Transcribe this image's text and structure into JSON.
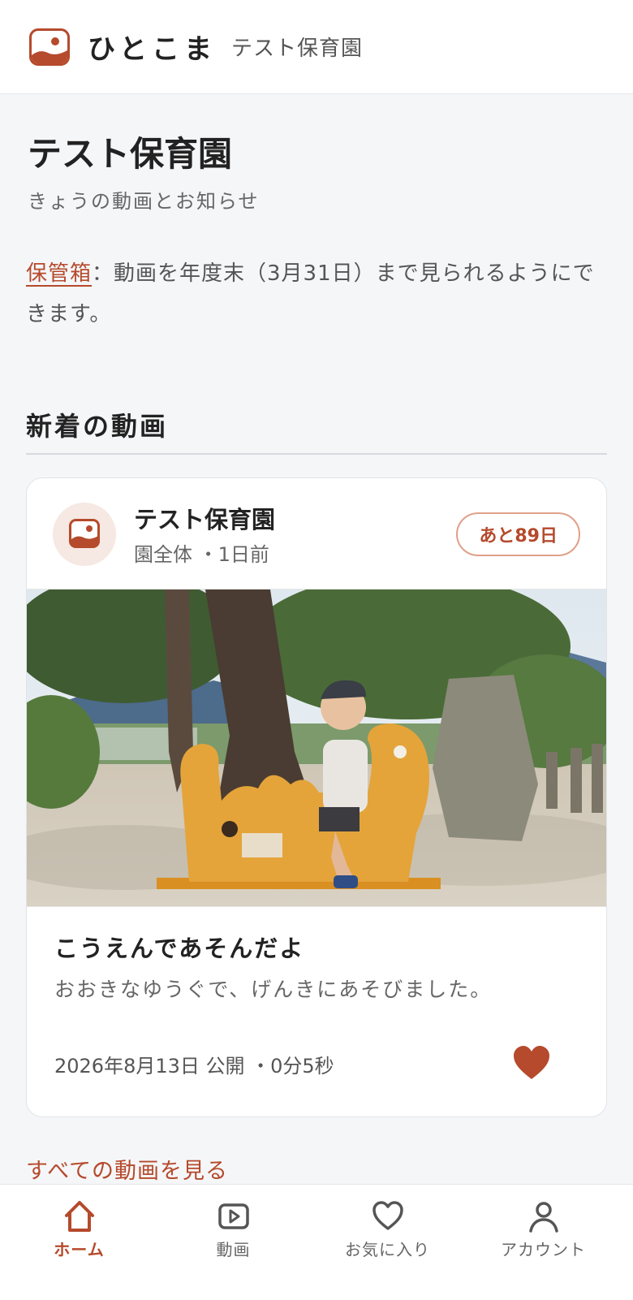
{
  "header": {
    "app_name": "ひとこま",
    "school_name": "テスト保育園",
    "logo_icon": "photo-logo-icon"
  },
  "main": {
    "title": "テスト保育園",
    "subtitle": "きょうの動画とお知らせ",
    "notice_link": "保管箱",
    "notice_text": "：動画を年度末（3月31日）まで見られるようにできます。"
  },
  "section": {
    "title": "新着の動画"
  },
  "video_card": {
    "org_name": "テスト保育園",
    "meta": "園全体 ・1日前",
    "badge": "あと89日",
    "title": "こうえんであそんだよ",
    "description": "おおきなゆうぐで、げんきにあそびました。",
    "date_info": "2026年8月13日 公開 ・0分5秒",
    "favorited": true,
    "thumbnail_icon": "video-thumbnail"
  },
  "links": {
    "all_videos": "すべての動画を見る"
  },
  "bottom_nav": {
    "items": [
      {
        "label": "ホーム",
        "icon": "home-icon",
        "active": true
      },
      {
        "label": "動画",
        "icon": "video-icon",
        "active": false
      },
      {
        "label": "お気に入り",
        "icon": "heart-icon",
        "active": false
      },
      {
        "label": "アカウント",
        "icon": "user-icon",
        "active": false
      }
    ]
  },
  "colors": {
    "accent": "#b54a2c",
    "background": "#f5f6f8",
    "card": "#ffffff"
  }
}
